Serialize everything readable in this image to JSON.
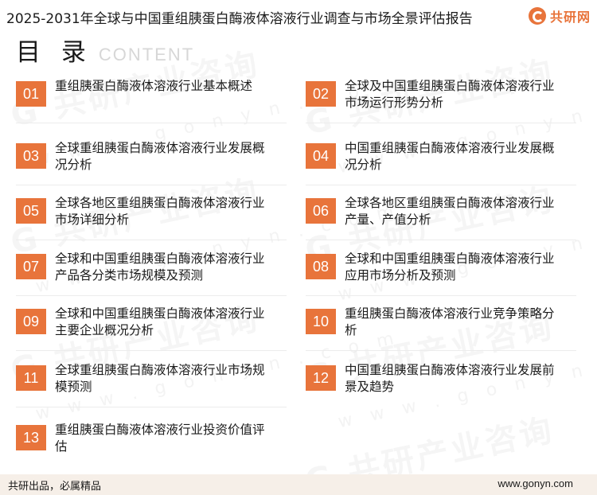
{
  "header": {
    "report_title": "2025-2031年全球与中国重组胰蛋白酶液体溶液行业调查与市场全景评估报告",
    "logo_text": "共研网",
    "logo_icon": "gonyn-logo-icon"
  },
  "toc": {
    "title": "目 录",
    "subtitle": "CONTENT"
  },
  "entries": [
    {
      "num": "01",
      "label": "重组胰蛋白酶液体溶液行业基本概述"
    },
    {
      "num": "02",
      "label": "全球及中国重组胰蛋白酶液体溶液行业市场运行形势分析"
    },
    {
      "num": "03",
      "label": "全球重组胰蛋白酶液体溶液行业发展概况分析"
    },
    {
      "num": "04",
      "label": "中国重组胰蛋白酶液体溶液行业发展概况分析"
    },
    {
      "num": "05",
      "label": "全球各地区重组胰蛋白酶液体溶液行业市场详细分析"
    },
    {
      "num": "06",
      "label": "全球各地区重组胰蛋白酶液体溶液行业产量、产值分析"
    },
    {
      "num": "07",
      "label": "全球和中国重组胰蛋白酶液体溶液行业产品各分类市场规模及预测"
    },
    {
      "num": "08",
      "label": "全球和中国重组胰蛋白酶液体溶液行业应用市场分析及预测"
    },
    {
      "num": "09",
      "label": "全球和中国重组胰蛋白酶液体溶液行业主要企业概况分析"
    },
    {
      "num": "10",
      "label": "重组胰蛋白酶液体溶液行业竞争策略分析"
    },
    {
      "num": "11",
      "label": "全球重组胰蛋白酶液体溶液行业市场规模预测"
    },
    {
      "num": "12",
      "label": "中国重组胰蛋白酶液体溶液行业发展前景及趋势"
    },
    {
      "num": "13",
      "label": "重组胰蛋白酶液体溶液行业投资价值评估"
    }
  ],
  "footer": {
    "slogan": "共研出品，必属精品",
    "website": "www.gonyn.com"
  },
  "colors": {
    "accent": "#e8743b",
    "footer_bg": "#f6efe8"
  }
}
